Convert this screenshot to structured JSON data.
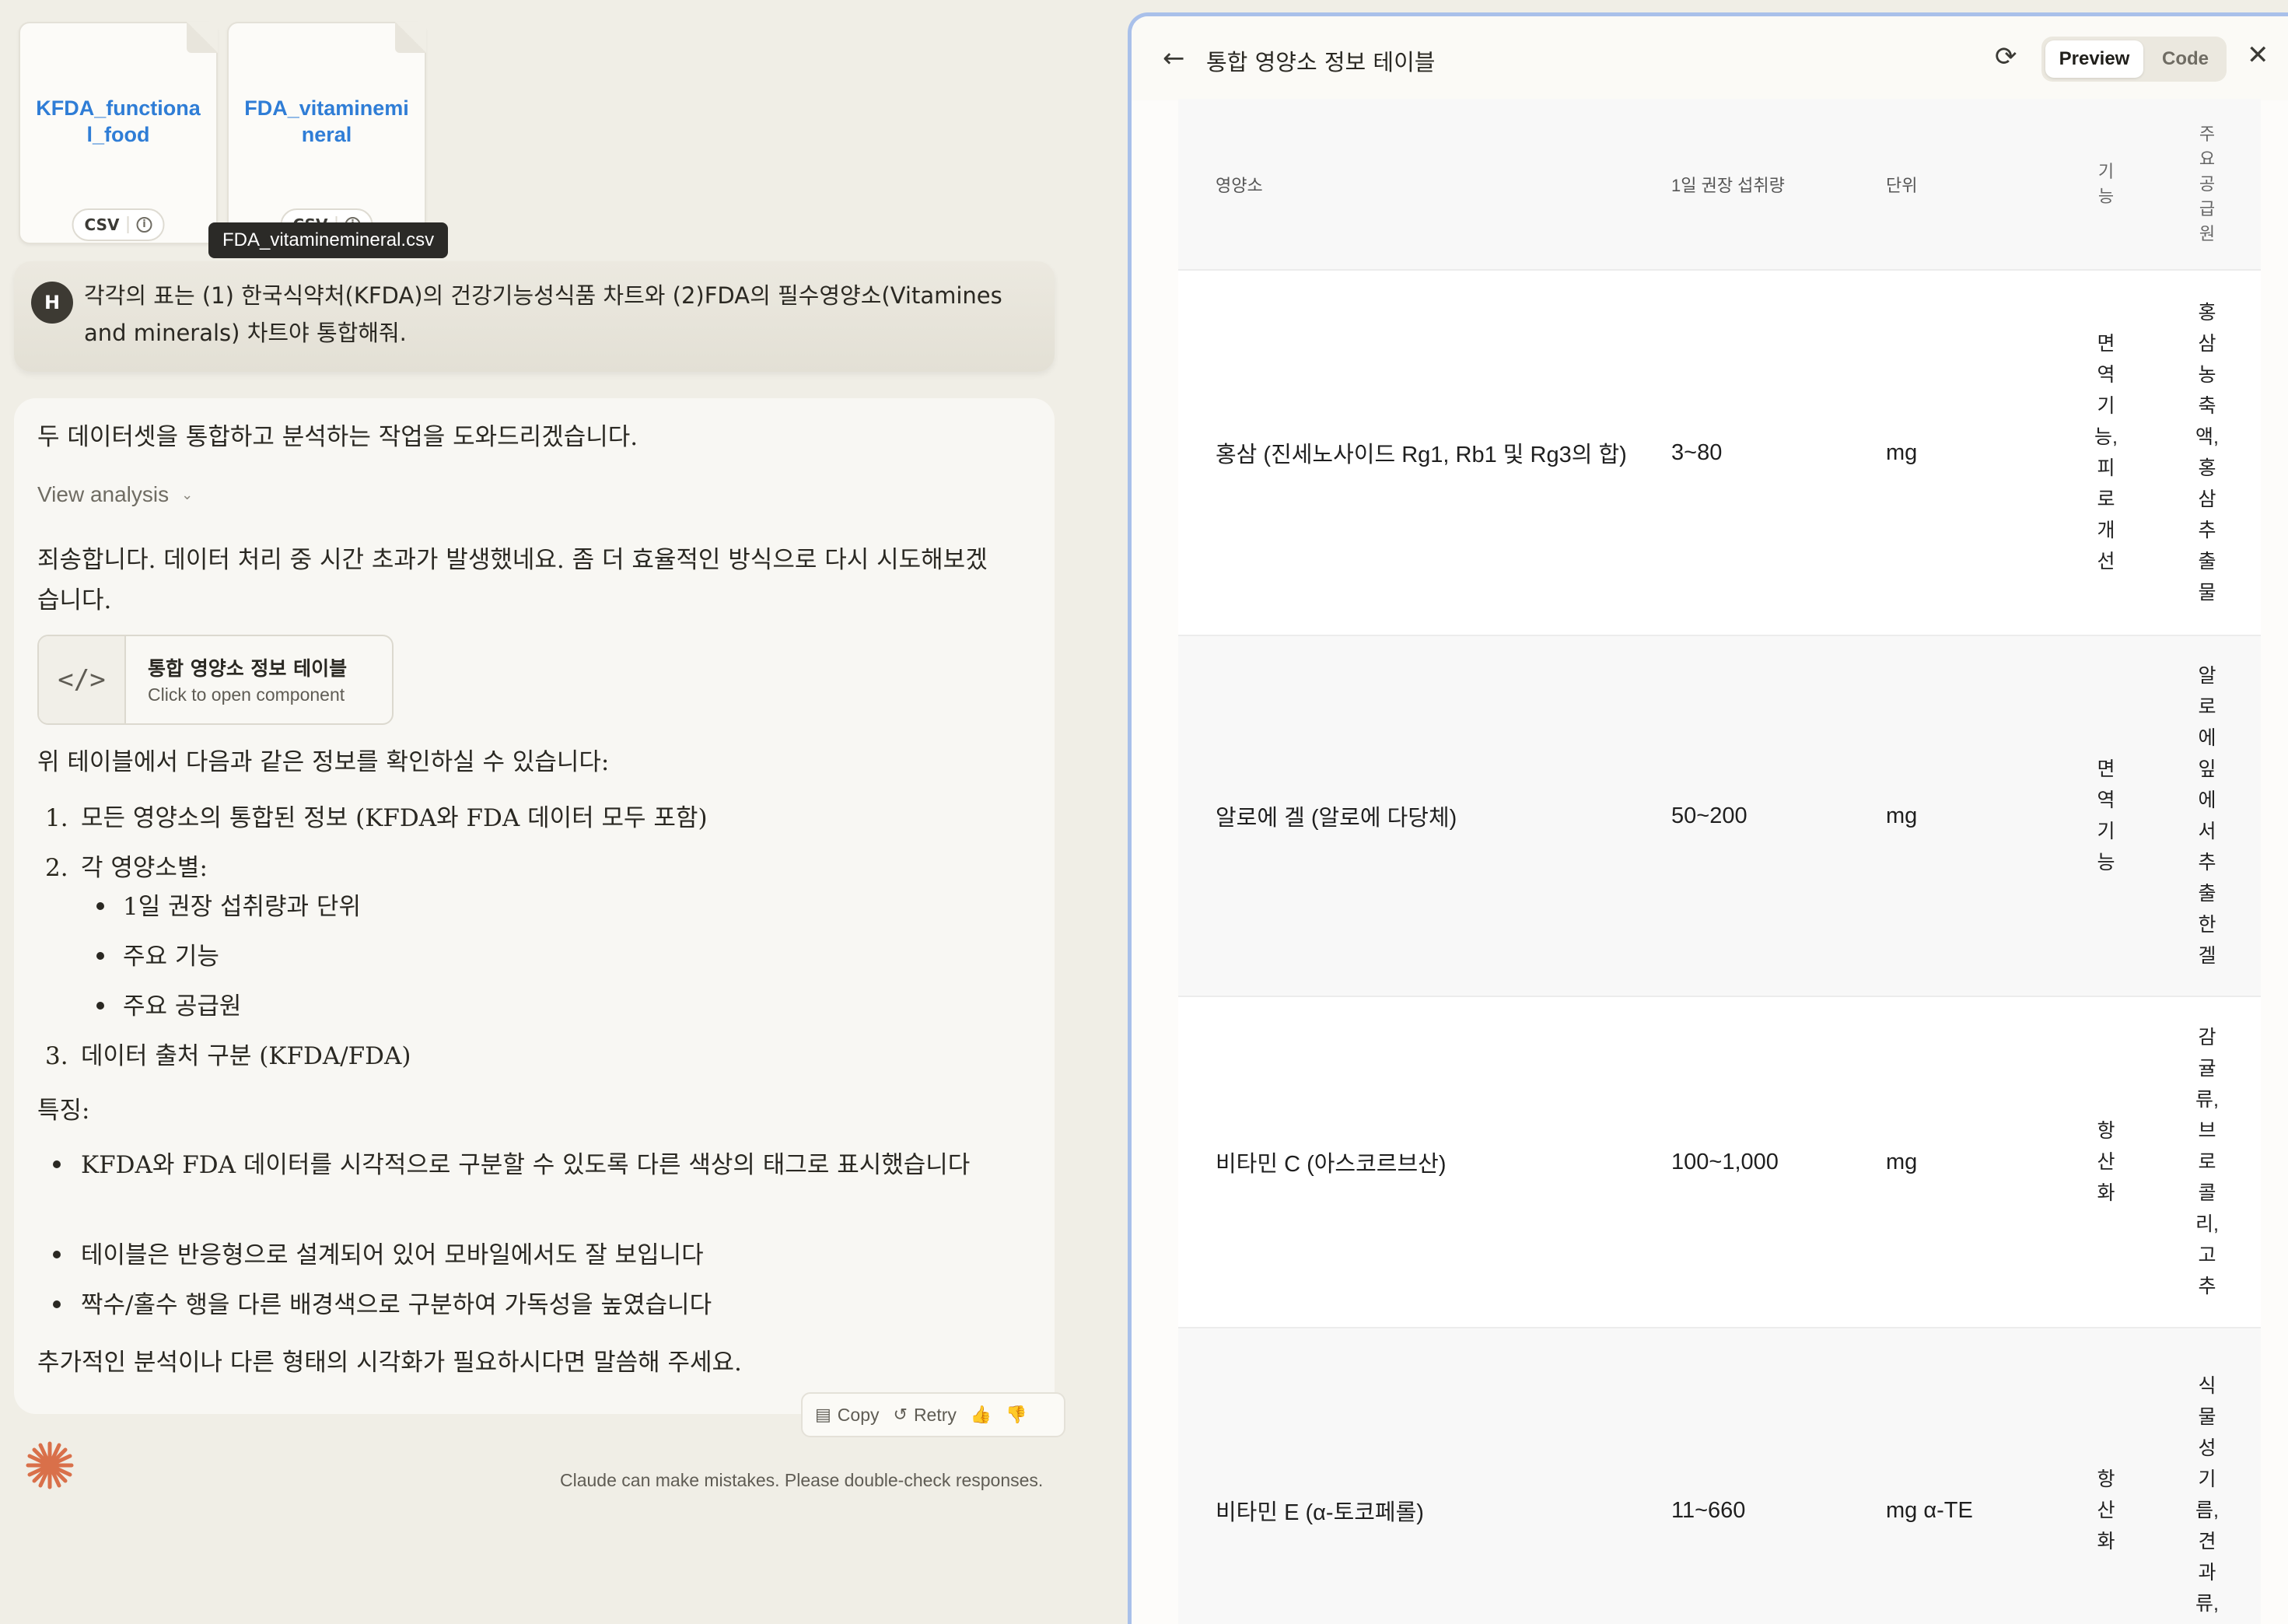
{
  "files": [
    {
      "name": "KFDA_functional_food",
      "type": "csv"
    },
    {
      "name": "FDA_vitaminemineral",
      "type": "csv"
    }
  ],
  "tooltip": "FDA_vitaminemineral.csv",
  "user": {
    "avatar": "H",
    "message": "각각의 표는 (1) 한국식약처(KFDA)의 건강기능성식품 차트와 (2)FDA의 필수영양소(Vitamines and minerals) 차트야 통합해줘."
  },
  "assistant": {
    "intro": "두 데이터셋을 통합하고 분석하는 작업을 도와드리겠습니다.",
    "view_analysis": "View analysis",
    "apology": "죄송합니다. 데이터 처리 중 시간 초과가 발생했네요. 좀 더 효율적인 방식으로 다시 시도해보겠습니다.",
    "artifact": {
      "title": "통합 영양소 정보 테이블",
      "subtitle": "Click to open component",
      "icon": "code-icon"
    },
    "lead": "위 테이블에서 다음과 같은 정보를 확인하실 수 있습니다:",
    "list": [
      {
        "num": "1.",
        "text": "모든 영양소의 통합된 정보 (KFDA와 FDA 데이터 모두 포함)"
      },
      {
        "num": "2.",
        "text": "각 영양소별:"
      },
      {
        "num": "3.",
        "text": "데이터 출처 구분 (KFDA/FDA)"
      }
    ],
    "sublist": [
      "1일 권장 섭취량과 단위",
      "주요 기능",
      "주요 공급원"
    ],
    "features_label": "특징:",
    "features": [
      "KFDA와 FDA 데이터를 시각적으로 구분할 수 있도록 다른 색상의 태그로 표시했습니다",
      "테이블은 반응형으로 설계되어 있어 모바일에서도 잘 보입니다",
      "짝수/홀수 행을 다른 배경색으로 구분하여 가독성을 높였습니다"
    ],
    "closing": "추가적인 분석이나 다른 형태의 시각화가 필요하시다면 말씀해 주세요.",
    "actions": {
      "copy": "Copy",
      "retry": "Retry"
    }
  },
  "disclaimer": "Claude can make mistakes. Please double-check responses.",
  "panel": {
    "title": "통합 영양소 정보 테이블",
    "toggle": {
      "preview": "Preview",
      "code": "Code"
    },
    "columns": [
      "영양소",
      "1일 권장 섭취량",
      "단위",
      "기능",
      "주요 공급원"
    ],
    "rows": [
      {
        "name": "홍삼 (진세노사이드 Rg1, Rb1 및 Rg3의 합)",
        "intake": "3~80",
        "unit": "mg",
        "function": "면역기능,피로개선",
        "source": "홍삼농축액,홍삼추출물"
      },
      {
        "name": "알로에 겔 (알로에 다당체)",
        "intake": "50~200",
        "unit": "mg",
        "function": "면역기능",
        "source": "알로에잎에서추출한겔"
      },
      {
        "name": "비타민 C (아스코르브산)",
        "intake": "100~1,000",
        "unit": "mg",
        "function": "항산화",
        "source": "감귤류,브로콜리,고추"
      },
      {
        "name": "비타민 E (α-토코페롤)",
        "intake": "11~660",
        "unit": "mg α-TE",
        "function": "항산화",
        "source": "식물성기름,견과류,씨"
      }
    ]
  }
}
